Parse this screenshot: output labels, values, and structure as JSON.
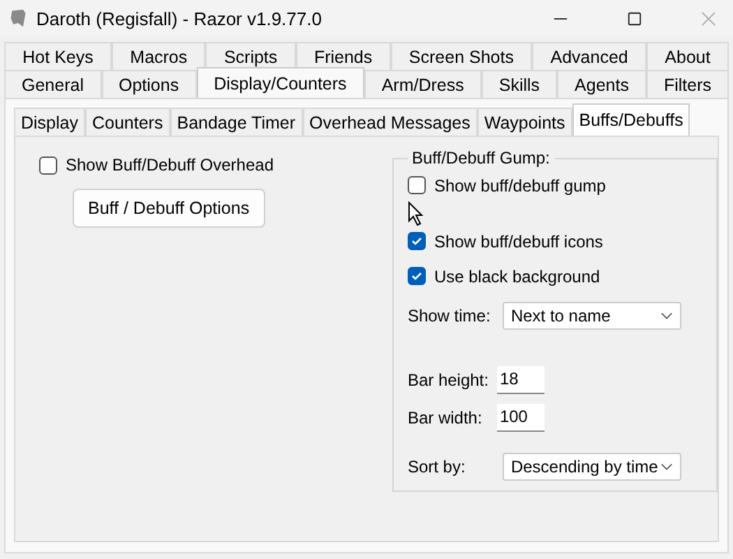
{
  "window": {
    "title": "Daroth (Regisfall) - Razor v1.9.77.0"
  },
  "tab_rows": [
    [
      {
        "label": "Hot Keys",
        "selected": false
      },
      {
        "label": "Macros",
        "selected": false
      },
      {
        "label": "Scripts",
        "selected": false
      },
      {
        "label": "Friends",
        "selected": false
      },
      {
        "label": "Screen Shots",
        "selected": false
      },
      {
        "label": "Advanced",
        "selected": false
      },
      {
        "label": "About",
        "selected": false
      }
    ],
    [
      {
        "label": "General",
        "selected": false
      },
      {
        "label": "Options",
        "selected": false
      },
      {
        "label": "Display/Counters",
        "selected": true
      },
      {
        "label": "Arm/Dress",
        "selected": false
      },
      {
        "label": "Skills",
        "selected": false
      },
      {
        "label": "Agents",
        "selected": false
      },
      {
        "label": "Filters",
        "selected": false
      }
    ]
  ],
  "subtabs": [
    {
      "label": "Display",
      "selected": false
    },
    {
      "label": "Counters",
      "selected": false
    },
    {
      "label": "Bandage Timer",
      "selected": false
    },
    {
      "label": "Overhead Messages",
      "selected": false
    },
    {
      "label": "Waypoints",
      "selected": false
    },
    {
      "label": "Buffs/Debuffs",
      "selected": true
    }
  ],
  "overhead": {
    "label": "Show Buff/Debuff Overhead",
    "checked": false
  },
  "options_button": "Buff / Debuff Options",
  "gump": {
    "title": "Buff/Debuff Gump:",
    "rows": [
      {
        "kind": "checkbox",
        "label": "Show buff/debuff gump",
        "checked": false
      },
      {
        "kind": "checkbox",
        "label": "Show buff/debuff icons",
        "checked": true
      },
      {
        "kind": "checkbox",
        "label": "Use black background",
        "checked": true
      },
      {
        "kind": "dropdown",
        "label": "Show time:",
        "value": "Next to name"
      },
      {
        "kind": "number",
        "label": "Bar height:",
        "value": "18"
      },
      {
        "kind": "number",
        "label": "Bar width:",
        "value": "100"
      },
      {
        "kind": "dropdown",
        "label": "Sort by:",
        "value": "Descending by time"
      }
    ]
  }
}
